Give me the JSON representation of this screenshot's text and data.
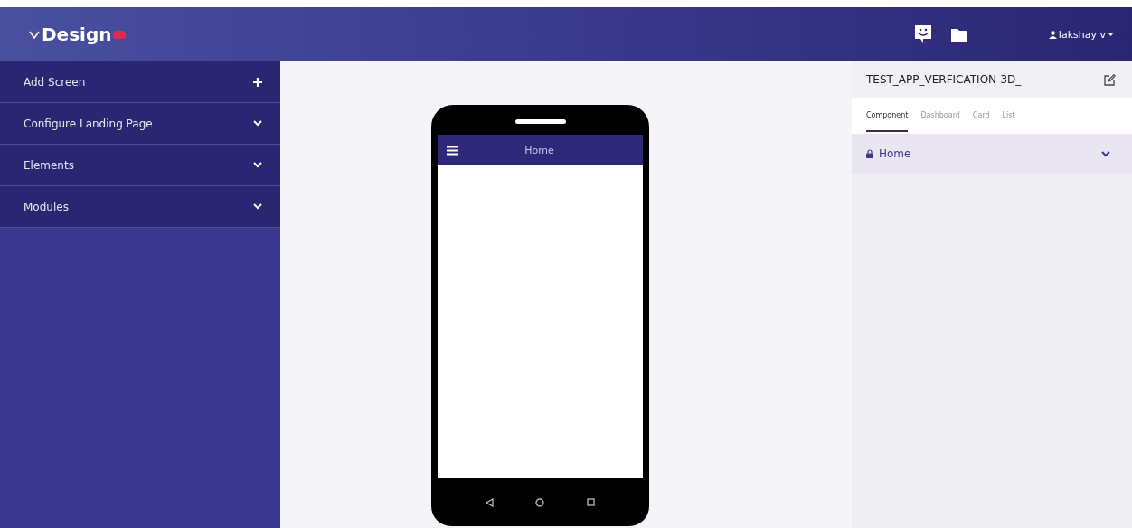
{
  "header": {
    "logo": "Design",
    "user": "lakshay v"
  },
  "sidebar": {
    "items": [
      {
        "label": "Add Screen",
        "kind": "add"
      },
      {
        "label": "Configure Landing Page",
        "kind": "expand",
        "expanded": false
      },
      {
        "label": "Elements",
        "kind": "expand",
        "expanded": false
      },
      {
        "label": "Modules",
        "kind": "expand",
        "expanded": false
      }
    ]
  },
  "phone": {
    "title": "Home"
  },
  "panel": {
    "title": "TEST_APP_VERFICATION-3D_",
    "tabs": [
      {
        "label": "Component",
        "selected": true
      },
      {
        "label": "Dashboard",
        "selected": false
      },
      {
        "label": "Card",
        "selected": false
      },
      {
        "label": "List",
        "selected": false
      }
    ],
    "screens": [
      {
        "label": "Home",
        "locked": true,
        "expanded": false
      }
    ]
  }
}
